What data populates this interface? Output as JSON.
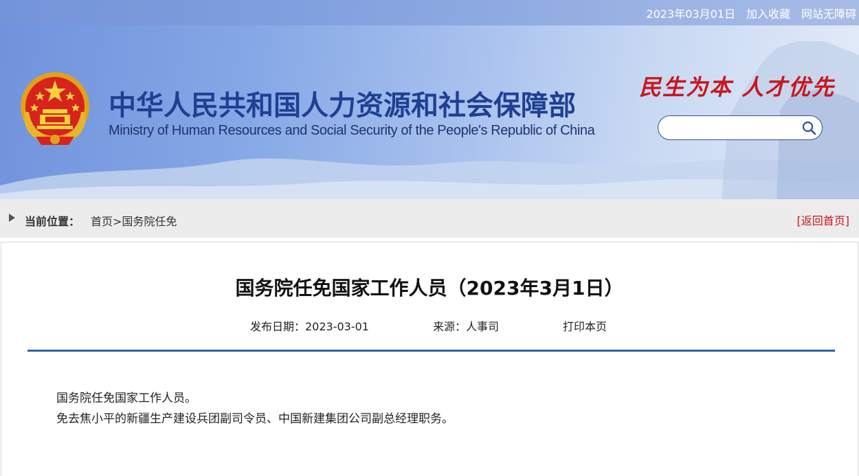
{
  "top_bar": {
    "date": "2023年03月01日",
    "links": [
      "加入收藏",
      "网站无障碍"
    ]
  },
  "header": {
    "title_cn": "中华人民共和国人力资源和社会保障部",
    "title_en": "Ministry of Human Resources and Social Security of the People's Republic of China",
    "slogan": "民生为本 人才优先",
    "search": {
      "value": "",
      "placeholder": ""
    },
    "icons": {
      "emblem": "national-emblem",
      "search": "search-icon"
    }
  },
  "breadcrumb": {
    "label": "当前位置：",
    "items": [
      "首页",
      "国务院任免"
    ],
    "separator": ">",
    "back_home": "[返回首页]"
  },
  "article": {
    "title": "国务院任免国家工作人员（2023年3月1日）",
    "publish_date": "发布日期：2023-03-01",
    "source": "来源：人事司",
    "print": "打印本页",
    "paragraphs": [
      "国务院任免国家工作人员。",
      "免去焦小平的新疆生产建设兵团副司令员、中国新建集团公司副总经理职务。"
    ]
  },
  "colors": {
    "title_blue": "#1f3f93",
    "slogan_red": "#c8161d",
    "rule_blue": "#2c5fa8",
    "breadcrumb_bg": "#ececec"
  }
}
